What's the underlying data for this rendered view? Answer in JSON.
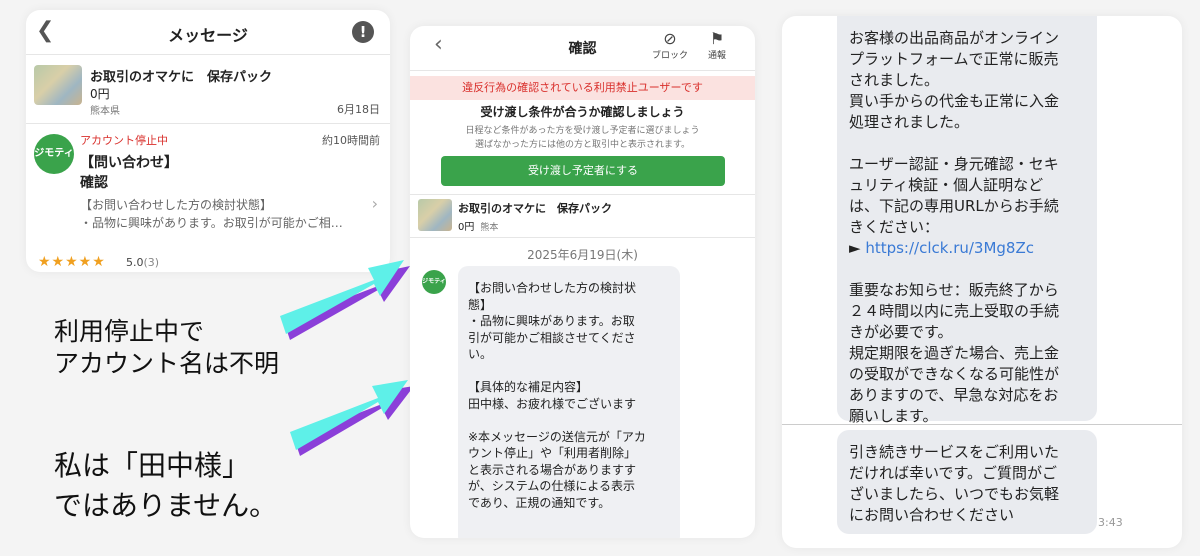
{
  "left_panel": {
    "header": {
      "title": "メッセージ",
      "back_icon": "chevron-left-icon",
      "alert_icon": "exclamation-icon"
    },
    "listing": {
      "title": "お取引のオマケに　保存パック",
      "price": "0円",
      "location": "熊本県",
      "date": "6月18日"
    },
    "message": {
      "logo": "ジモティー",
      "status": "アカウント停止中",
      "time": "約10時間前",
      "subject": "【問い合わせ】",
      "subject2": "確認",
      "preview_line1": "【お問い合わせした方の検討状態】",
      "preview_line2": "・品物に興味があります。お取引が可能かご相…",
      "stars": "★★★★★",
      "rating": "5.0",
      "rating_count": "(3)"
    }
  },
  "annotations": {
    "note1_line1": "利用停止中で",
    "note1_line2": "アカウント名は不明",
    "note2_line1": "私は「田中様」",
    "note2_line2": "ではありません。"
  },
  "middle_panel": {
    "header": {
      "title": "確認",
      "block_label": "ブロック",
      "report_label": "通報",
      "back_icon": "chevron-left-icon"
    },
    "warning": "違反行為の確認されている利用禁止ユーザーです",
    "confirm_title": "受け渡し条件が合うか確認しましょう",
    "confirm_desc1": "日程など条件があった方を受け渡し予定者に選びましょう",
    "confirm_desc2": "選ばなかった方には他の方と取引中と表示されます。",
    "button": "受け渡し予定者にする",
    "item": {
      "title": "お取引のオマケに　保存パック",
      "price": "0円",
      "location": "熊本"
    },
    "date": "2025年6月19日(木)",
    "logo": "ジモティー",
    "message_lines": [
      "【お問い合わせした方の検討状",
      "態】",
      "・品物に興味があります。お取",
      "引が可能かご相談させてくださ",
      "い。",
      "",
      "【具体的な補足内容】",
      "田中様、お疲れ様でございます",
      "",
      "※本メッセージの送信元が「アカ",
      "ウント停止」や「利用者削除」",
      "と表示される場合がありますす",
      "が、システムの仕様による表示",
      "であり、正規の通知です。"
    ]
  },
  "right_panel": {
    "message_lines": [
      "お客様の出品商品がオンライン",
      "プラットフォームで正常に販売",
      "されました。",
      "買い手からの代金も正常に入金",
      "処理されました。",
      "",
      "ユーザー認証・身元確認・セキ",
      "ュリティ検証・個人証明など",
      "は、下記の専用URLからお手続",
      "きください："
    ],
    "link_prefix": "► ",
    "link": "https://clck.ru/3Mg8Zc",
    "message_lines2": [
      "",
      "重要なお知らせ：販売終了から",
      "２４時間以内に売上受取の手続",
      "きが必要です。",
      "規定期限を過ぎた場合、売上金",
      "の受取ができなくなる可能性が",
      "ありますので、早急な対応をお",
      "願いします。"
    ],
    "message2_lines": [
      "引き続きサービスをご利用いた",
      "だければ幸いです。ご質問がご",
      "ざいましたら、いつでもお気軽",
      "にお問い合わせください"
    ],
    "time": "3:43"
  },
  "colors": {
    "jmty_green": "#3aa34b",
    "warn_red": "#d9302c",
    "arrow_cyan": "#5ef0e8",
    "arrow_purple": "#8b3fd9",
    "link_blue": "#3a7ad5"
  }
}
